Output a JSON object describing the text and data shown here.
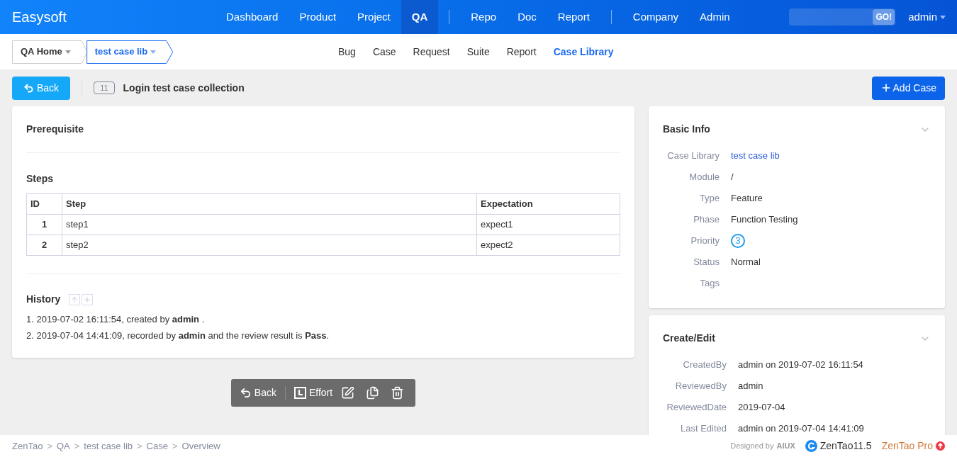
{
  "brand": "Easysoft",
  "main_nav": [
    [
      {
        "label": "Dashboard",
        "selected": false
      },
      {
        "label": "Product",
        "selected": false
      },
      {
        "label": "Project",
        "selected": false
      },
      {
        "label": "QA",
        "selected": true
      }
    ],
    [
      {
        "label": "Repo",
        "selected": false
      },
      {
        "label": "Doc",
        "selected": false
      },
      {
        "label": "Report",
        "selected": false
      }
    ],
    [
      {
        "label": "Company",
        "selected": false
      },
      {
        "label": "Admin",
        "selected": false
      }
    ]
  ],
  "search": {
    "button": "GO!"
  },
  "user": "admin",
  "breadcrumb": [
    {
      "label": "QA Home",
      "selected": false
    },
    {
      "label": "test case lib",
      "selected": true
    }
  ],
  "sub_nav": [
    {
      "label": "Bug",
      "selected": false
    },
    {
      "label": "Case",
      "selected": false
    },
    {
      "label": "Request",
      "selected": false
    },
    {
      "label": "Suite",
      "selected": false
    },
    {
      "label": "Report",
      "selected": false
    },
    {
      "label": "Case Library",
      "selected": true
    }
  ],
  "toolbar": {
    "back": "Back",
    "id": "11",
    "title": "Login test case collection",
    "add": "Add Case"
  },
  "prerequisite": {
    "title": "Prerequisite"
  },
  "steps": {
    "title": "Steps",
    "columns": [
      "ID",
      "Step",
      "Expectation"
    ],
    "rows": [
      [
        "1",
        "step1",
        "expect1"
      ],
      [
        "2",
        "step2",
        "expect2"
      ]
    ]
  },
  "history": {
    "title": "History",
    "entries": [
      "1. 2019-07-02 16:11:54, created by **admin** .",
      "2. 2019-07-04 14:41:09, recorded by **admin** and the review result is **Pass**."
    ]
  },
  "actions": {
    "back": "Back",
    "effort": "Effort"
  },
  "basic_info": {
    "title": "Basic Info",
    "fields": [
      {
        "label": "Case Library",
        "value": "test case lib",
        "kind": "link"
      },
      {
        "label": "Module",
        "value": "/",
        "kind": "text"
      },
      {
        "label": "Type",
        "value": "Feature",
        "kind": "text"
      },
      {
        "label": "Phase",
        "value": "Function Testing",
        "kind": "text"
      },
      {
        "label": "Priority",
        "value": "3",
        "kind": "priority"
      },
      {
        "label": "Status",
        "value": "Normal",
        "kind": "text"
      },
      {
        "label": "Tags"
      }
    ]
  },
  "create_edit": {
    "title": "Create/Edit",
    "fields": [
      {
        "label": "CreatedBy",
        "value": "admin on 2019-07-02 16:11:54"
      },
      {
        "label": "ReviewedBy",
        "value": "admin"
      },
      {
        "label": "ReviewedDate",
        "value": "2019-07-04"
      },
      {
        "label": "Last Edited",
        "value": "admin on 2019-07-04 14:41:09"
      }
    ]
  },
  "footer": {
    "path": [
      "ZenTao",
      "QA",
      "test case lib",
      "Case",
      "Overview"
    ],
    "separator": ">",
    "designed_by": "Designed by",
    "designer": "AIUX",
    "version": "ZenTao11.5",
    "pro": "ZenTao Pro"
  }
}
